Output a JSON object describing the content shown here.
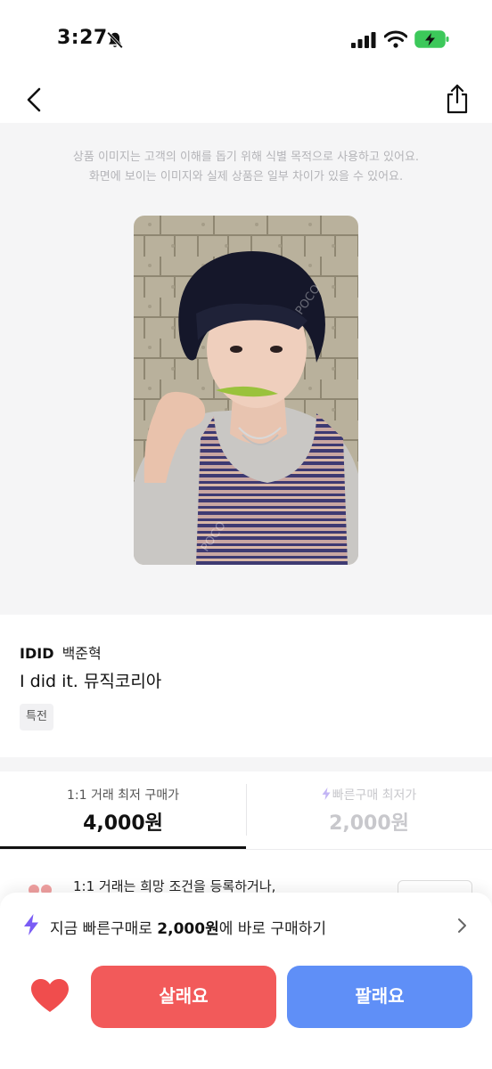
{
  "status_bar": {
    "time": "3:27",
    "icons": [
      "bell-slash-icon",
      "cellular-signal-icon",
      "wifi-icon",
      "battery-charging-icon"
    ]
  },
  "nav": {
    "icons": [
      "chevron-left-icon",
      "share-icon"
    ]
  },
  "image_section": {
    "disclaimer_line1": "상품 이미지는 고객의 이해를 돕기 위해 식별 목적으로 사용하고 있어요.",
    "disclaimer_line2": "화면에 보이는 이미지와 실제 상품은 일부 차이가 있을 수 있어요.",
    "watermark": "POCO"
  },
  "product": {
    "brand": "IDID",
    "member": "백준혁",
    "name": "I did it. 뮤직코리아",
    "tag": "특전"
  },
  "price_tabs": [
    {
      "label": "1:1 거래 최저 구매가",
      "value": "4,000원",
      "selected": true
    },
    {
      "label": "빠른구매 최저가",
      "value": "2,000원",
      "selected": false,
      "icon": "bolt-icon"
    }
  ],
  "notice": {
    "text": "1:1 거래는 희망 조건을 등록하거나,"
  },
  "bottom_bar": {
    "quick_prefix": "지금 빠른구매로 ",
    "quick_price": "2,000원",
    "quick_suffix": "에 바로 구매하기",
    "buy_label": "살래요",
    "sell_label": "팔래요"
  },
  "colors": {
    "buy": "#f25a5a",
    "sell": "#5f8ff7",
    "bolt": "#7a5cf5",
    "heart": "#f04d4d"
  }
}
